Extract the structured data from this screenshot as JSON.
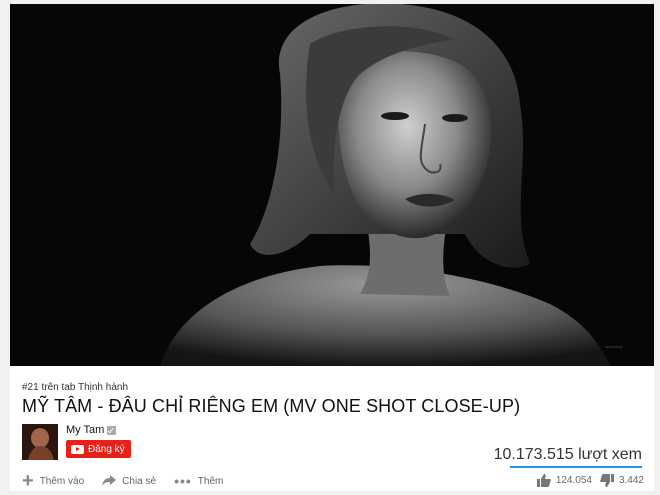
{
  "video": {
    "trending": "#21 trên tab Thịnh hành",
    "title": "MỸ TÂM - ĐÂU CHỈ RIÊNG EM (MV ONE SHOT CLOSE-UP)"
  },
  "channel": {
    "name": "My Tam",
    "subscribe_label": "Đăng ký"
  },
  "stats": {
    "views": "10.173.515 lượt xem",
    "likes": "124.054",
    "dislikes": "3.442"
  },
  "actions": {
    "add_label": "Thêm vào",
    "share_label": "Chia sẻ",
    "more_label": "Thêm"
  },
  "icons": [
    "play-logo-icon",
    "verified-icon",
    "plus-icon",
    "share-icon",
    "more-icon",
    "thumbs-up-icon",
    "thumbs-down-icon"
  ],
  "colors": {
    "subscribe": "#e62117",
    "sentiment_bar": "#2793e6"
  }
}
